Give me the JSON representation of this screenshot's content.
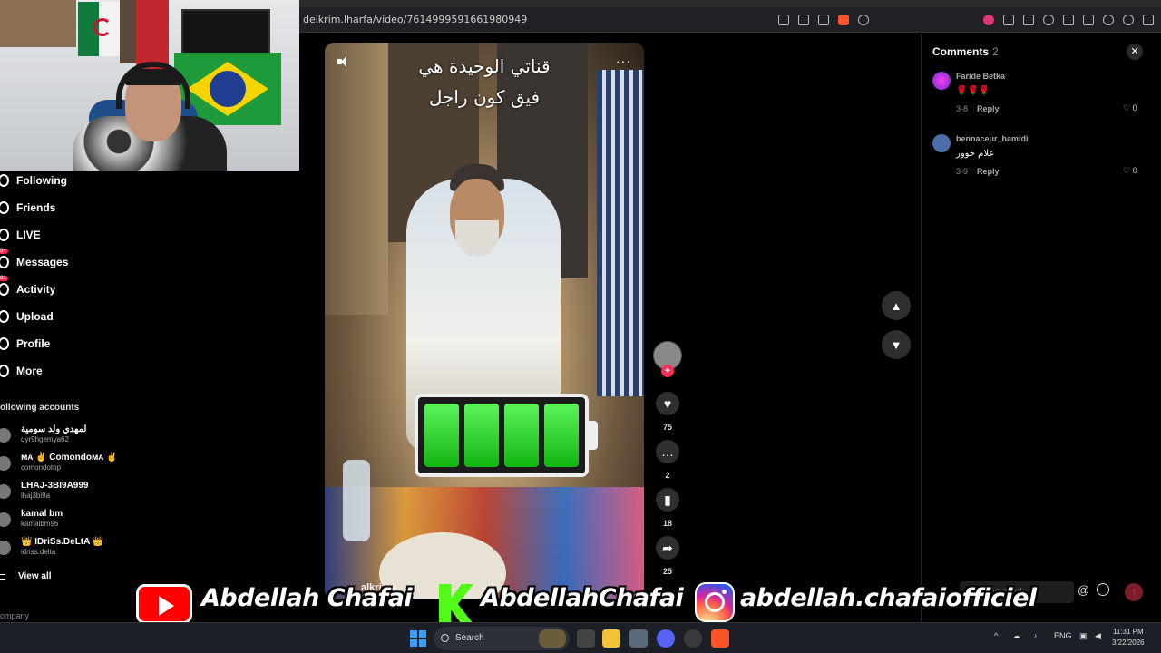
{
  "browser": {
    "url": "delkrim.lharfa/video/7614999591661980949"
  },
  "sidebar": {
    "items": [
      {
        "label": "Following",
        "icon": "following-icon"
      },
      {
        "label": "Friends",
        "icon": "friends-icon"
      },
      {
        "label": "LIVE",
        "icon": "live-icon"
      },
      {
        "label": "Messages",
        "icon": "messages-icon",
        "badge": "9+"
      },
      {
        "label": "Activity",
        "icon": "activity-icon",
        "badge": "81"
      },
      {
        "label": "Upload",
        "icon": "upload-icon"
      },
      {
        "label": "Profile",
        "icon": "profile-icon"
      },
      {
        "label": "More",
        "icon": "more-icon"
      }
    ],
    "following_title": "ollowing accounts",
    "accounts": [
      {
        "name": "لمهدي ولد سومية",
        "handle": "dyr9hgemya62"
      },
      {
        "name": "ᴍᴀ ✌ Comondoᴍᴀ ✌",
        "handle": "comondotop"
      },
      {
        "name": "LHAJ-3BI9A999",
        "handle": "lhaj3bi9a"
      },
      {
        "name": "kamal bm",
        "handle": "kamalbm96"
      },
      {
        "name": "👑 IDriSs.DeLtA 👑",
        "handle": "idriss.delta"
      }
    ],
    "view_all": "View all",
    "company": "ompany"
  },
  "video": {
    "caption_line1": "قناتي الوحيدة هي",
    "caption_line2": "فيق كون راجل",
    "more": "···",
    "watermark": "alkrim",
    "battery_level": 1.0
  },
  "actions": {
    "likes": "75",
    "comments": "2",
    "saves": "18",
    "shares": "25"
  },
  "comments_panel": {
    "title": "Comments",
    "count": "2",
    "close": "✕",
    "comments": [
      {
        "user": "Faride Betka",
        "text": "🌹🌹🌹",
        "date": "3-8",
        "reply": "Reply",
        "likes": "0"
      },
      {
        "user": "bennaceur_hamidi",
        "text": "علام خوور",
        "date": "3-9",
        "reply": "Reply",
        "likes": "0"
      }
    ],
    "input_placeholder": "comment...",
    "at": "@"
  },
  "banner": {
    "youtube": "Abdellah Chafai",
    "kick": "AbdellahChafai",
    "instagram": "abdellah.chafaiofficiel"
  },
  "taskbar": {
    "search": "Search",
    "lang": "ENG",
    "time": "11:31 PM",
    "date": "3/22/2026"
  }
}
